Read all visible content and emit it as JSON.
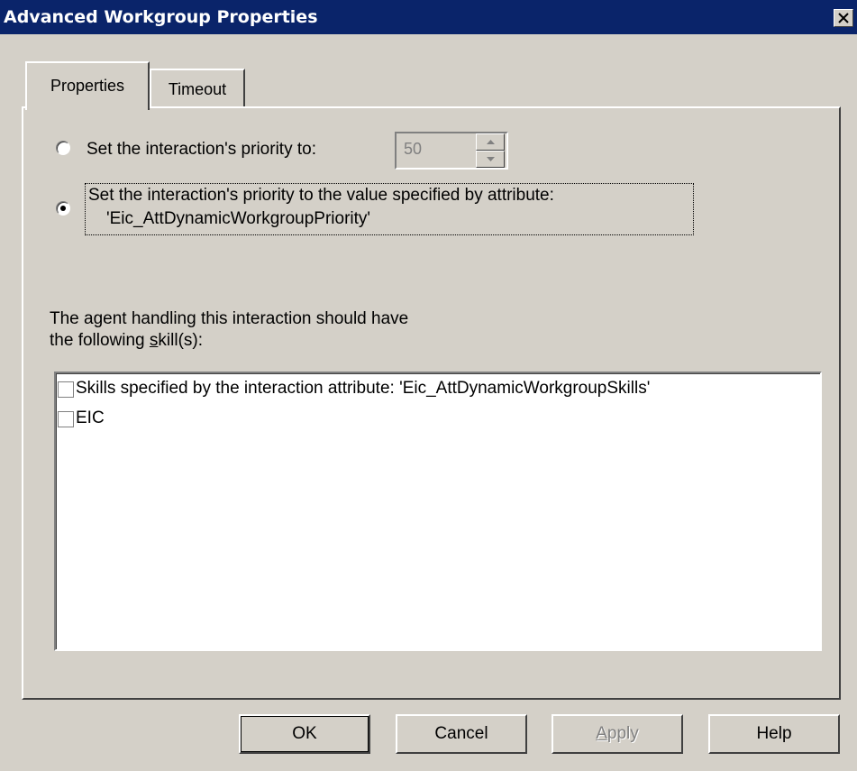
{
  "window": {
    "title": "Advanced Workgroup Properties",
    "close_glyph": "✕"
  },
  "tabs": [
    {
      "label": "Properties",
      "selected": true
    },
    {
      "label": "Timeout",
      "selected": false
    }
  ],
  "priority": {
    "option1_label": "Set the interaction's priority to:",
    "option1_selected": false,
    "spinner_value": "50",
    "spinner_enabled": false,
    "option2_label_line1": "Set the interaction's priority to the value specified by attribute:",
    "option2_label_line2": "'Eic_AttDynamicWorkgroupPriority'",
    "option2_selected": true
  },
  "skills": {
    "label_line1": "The agent handling this interaction should have",
    "label_line2_prefix": "the following ",
    "label_line2_mnemonic": "s",
    "label_line2_suffix": "kill(s):",
    "items": [
      {
        "label": "Skills specified by the interaction attribute: 'Eic_AttDynamicWorkgroupSkills'",
        "checked": false
      },
      {
        "label": "EIC",
        "checked": false
      }
    ]
  },
  "buttons": {
    "ok": "OK",
    "cancel": "Cancel",
    "apply_mnemonic": "A",
    "apply_rest": "pply",
    "help": "Help"
  },
  "colors": {
    "titlebar": "#0a246a",
    "face": "#d4d0c8",
    "disabled_text": "#808080"
  }
}
